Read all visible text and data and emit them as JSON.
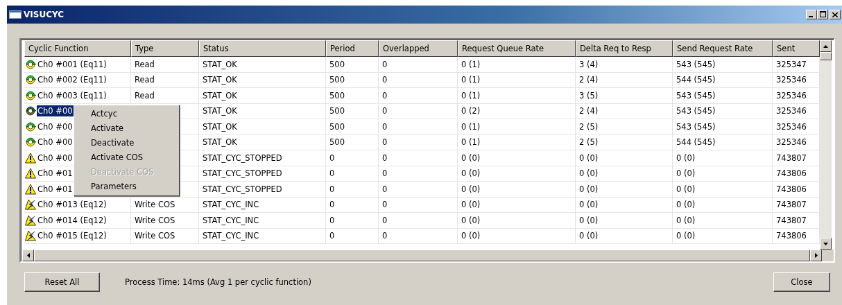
{
  "window": {
    "title": "VISUCYC"
  },
  "table": {
    "columns": [
      "Cyclic Function",
      "Type",
      "Status",
      "Period",
      "Overlapped",
      "Request Queue Rate",
      "Delta Req to Resp",
      "Send Request Rate",
      "Sent"
    ],
    "rows": [
      {
        "kind": "cycle",
        "selected": false,
        "cells": [
          "Ch0 #001 (Eq11)",
          "Read",
          "STAT_OK",
          "500",
          "0",
          "0 (1)",
          "3 (4)",
          "543 (545)",
          "325347"
        ]
      },
      {
        "kind": "cycle",
        "selected": false,
        "cells": [
          "Ch0 #002 (Eq11)",
          "Read",
          "STAT_OK",
          "500",
          "0",
          "0 (1)",
          "2 (4)",
          "544 (545)",
          "325346"
        ]
      },
      {
        "kind": "cycle",
        "selected": false,
        "cells": [
          "Ch0 #003 (Eq11)",
          "Read",
          "STAT_OK",
          "500",
          "0",
          "0 (1)",
          "3 (5)",
          "543 (545)",
          "325346"
        ]
      },
      {
        "kind": "cycle",
        "selected": true,
        "cells": [
          "Ch0 #00",
          null,
          "STAT_OK",
          "500",
          "0",
          "0 (2)",
          "2 (4)",
          "543 (545)",
          "325346"
        ]
      },
      {
        "kind": "cycle",
        "selected": false,
        "cells": [
          "Ch0 #00",
          null,
          "STAT_OK",
          "500",
          "0",
          "0 (1)",
          "2 (5)",
          "543 (545)",
          "325346"
        ]
      },
      {
        "kind": "cycle",
        "selected": false,
        "cells": [
          "Ch0 #00",
          null,
          "STAT_OK",
          "500",
          "0",
          "0 (1)",
          "2 (5)",
          "544 (545)",
          "325346"
        ]
      },
      {
        "kind": "warning",
        "selected": false,
        "cells": [
          "Ch0 #00",
          null,
          "STAT_CYC_STOPPED",
          "0",
          "0",
          "0 (0)",
          "0 (0)",
          "0 (0)",
          "743807"
        ]
      },
      {
        "kind": "warning",
        "selected": false,
        "cells": [
          "Ch0 #01",
          null,
          "STAT_CYC_STOPPED",
          "0",
          "0",
          "0 (0)",
          "0 (0)",
          "0 (0)",
          "743806"
        ]
      },
      {
        "kind": "warning",
        "selected": false,
        "cells": [
          "Ch0 #01",
          null,
          "STAT_CYC_STOPPED",
          "0",
          "0",
          "0 (0)",
          "0 (0)",
          "0 (0)",
          "743806"
        ]
      },
      {
        "kind": "lightning",
        "selected": false,
        "cells": [
          "Ch0 #013 (Eq12)",
          "Write COS",
          "STAT_CYC_INC",
          "0",
          "0",
          "0 (0)",
          "0 (0)",
          "0 (0)",
          "743807"
        ]
      },
      {
        "kind": "lightning",
        "selected": false,
        "cells": [
          "Ch0 #014 (Eq12)",
          "Write COS",
          "STAT_CYC_INC",
          "0",
          "0",
          "0 (0)",
          "0 (0)",
          "0 (0)",
          "743807"
        ]
      },
      {
        "kind": "lightning",
        "selected": false,
        "cells": [
          "Ch0 #015 (Eq12)",
          "Write COS",
          "STAT_CYC_INC",
          "0",
          "0",
          "0 (0)",
          "0 (0)",
          "0 (0)",
          "743806"
        ]
      }
    ]
  },
  "context_menu": {
    "items": [
      {
        "label": "Actcyc",
        "disabled": false
      },
      {
        "label": "Activate",
        "disabled": false
      },
      {
        "label": "Deactivate",
        "disabled": false
      },
      {
        "label": "Activate COS",
        "disabled": false
      },
      {
        "label": "Deactivate COS",
        "disabled": true
      },
      {
        "label": "Parameters",
        "disabled": false
      }
    ]
  },
  "footer": {
    "reset_button": "Reset All",
    "status": "Process Time: 14ms (Avg 1 per cyclic function)",
    "close_button": "Close"
  }
}
